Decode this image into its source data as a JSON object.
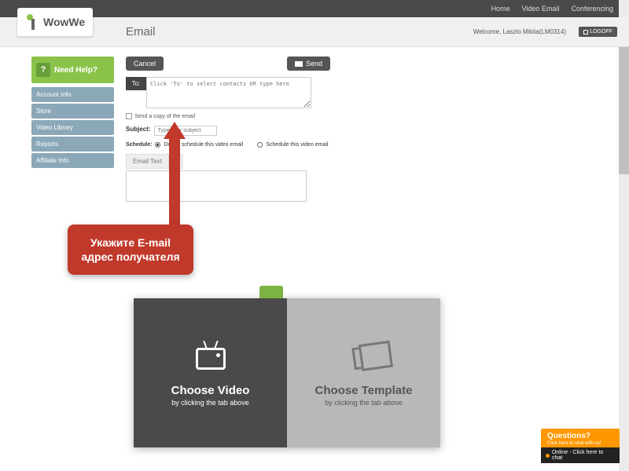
{
  "nav": {
    "home": "Home",
    "video_email": "Video Email",
    "conferencing": "Conferencing"
  },
  "logo": "WowWe",
  "page_title": "Email",
  "welcome": "Welcome, Laszlo Mikita(LM0314)",
  "logoff": "LOGOFF",
  "sidebar": {
    "help": "Need Help?",
    "items": [
      "Account Info",
      "Store",
      "Video Library",
      "Reports",
      "Affiliate Info"
    ]
  },
  "buttons": {
    "cancel": "Cancel",
    "send": "Send"
  },
  "form": {
    "to_label": "To:",
    "to_placeholder": "Click 'To' to select contacts OR type here",
    "send_copy": "Send a copy of the email",
    "subject_label": "Subject:",
    "subject_placeholder": "Type your subject",
    "schedule_label": "Schedule:",
    "schedule_opt1": "Do not schedule this video email",
    "schedule_opt2": "Schedule this video email",
    "tab_text": "Email Text"
  },
  "callout": "Укажите E-mail адрес получателя",
  "panels": {
    "video_title": "Choose Video",
    "video_sub": "by clicking the tab above",
    "template_title": "Choose Template",
    "template_sub": "by clicking the tab above"
  },
  "chat": {
    "title": "Questions?",
    "sub": "Click here to chat with us!",
    "online": "Online - Click here to chat"
  }
}
